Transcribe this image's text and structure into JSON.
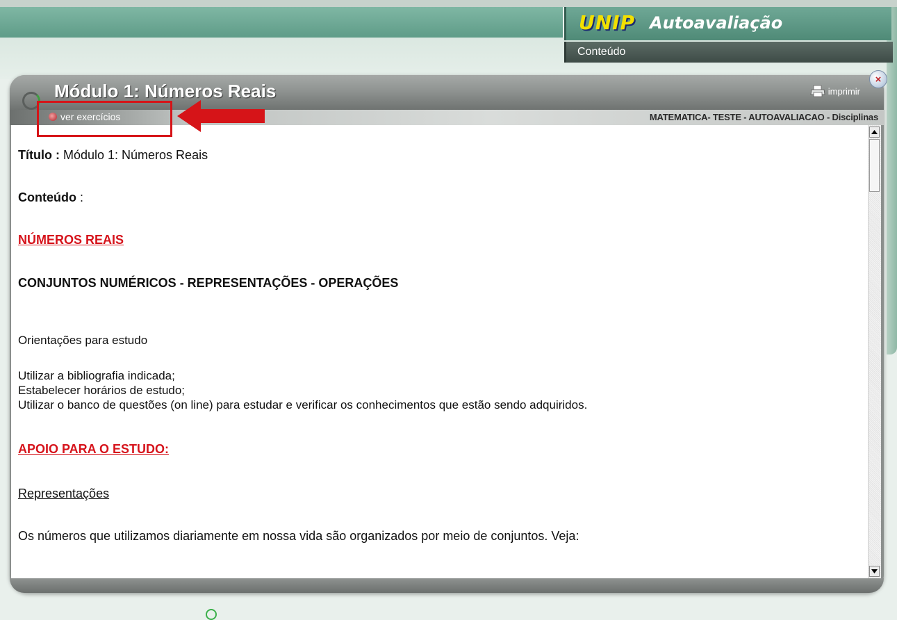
{
  "brand": {
    "logo": "UNIP",
    "title": "Autoavaliação"
  },
  "menu": {
    "item": "Conteúdo"
  },
  "modal": {
    "title": "Módulo 1: Números Reais",
    "print_label": "imprimir",
    "close_symbol": "×",
    "exercise_link": "ver exercícios",
    "breadcrumb": "MATEMATICA- TESTE - AUTOAVALIACAO - Disciplinas"
  },
  "content": {
    "titulo_label": "Título :",
    "titulo_value": " Módulo 1: Números Reais",
    "conteudo_label": "Conteúdo",
    "conteudo_colon": " :",
    "heading_red_1": "NÚMEROS REAIS ",
    "section_heading": "CONJUNTOS NUMÉRICOS - REPRESENTAÇÕES - OPERAÇÕES",
    "orientacoes": "Orientações para estudo",
    "list": [
      "Utilizar a bibliografia indicada;",
      "Estabelecer horários de estudo;",
      "Utilizar o banco de questões (on line) para estudar e verificar os conhecimentos que estão sendo adquiridos."
    ],
    "heading_red_2": "APOIO PARA O ESTUDO:",
    "representacoes": "Representações",
    "paragraph": "Os números que utilizamos diariamente em nossa vida são organizados por meio de conjuntos. Veja:"
  },
  "colors": {
    "accent_red": "#d6141c",
    "header_green": "#5f9c88",
    "modal_gray": "#8b8f8d",
    "logo_yellow": "#f2e000"
  },
  "icons": {
    "printer": "printer-icon",
    "close": "close-icon",
    "exercise": "exercise-bullet-icon",
    "loader": "loading-icon",
    "scroll_up": "arrow-up-icon",
    "scroll_down": "arrow-down-icon"
  }
}
